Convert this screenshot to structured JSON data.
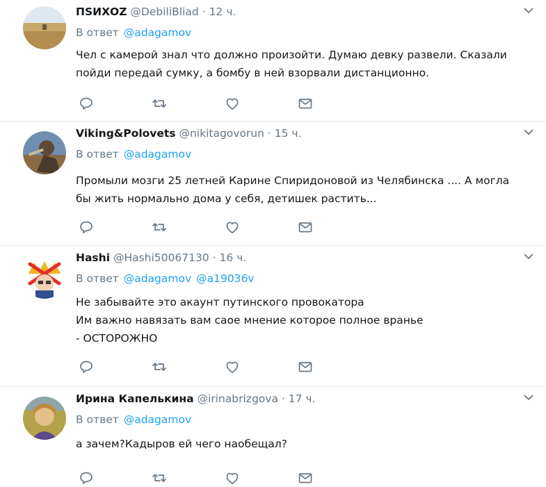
{
  "tweets": [
    {
      "name": "ПSИХОZ",
      "handle": "@DebiliBliad",
      "dot": "·",
      "time": "12 ч.",
      "reply_label": "В ответ",
      "mentions": [
        "@adagamov"
      ],
      "lines": [
        "Чел с камерой знал что должно произойти. Думаю девку развели. Сказали",
        "пойди передай сумку, а бомбу в ней взорвали дистанционно."
      ]
    },
    {
      "name": "Viking&Polovets",
      "handle": "@nikitagovorun",
      "dot": "·",
      "time": "15 ч.",
      "reply_label": "В ответ",
      "mentions": [
        "@adagamov"
      ],
      "lines": [
        "Промыли мозги 25 летней  Карине Спиридоновой из Челябинска .... А могла",
        "бы жить нормально дома у себя, детишек растить..."
      ]
    },
    {
      "name": "Hashi",
      "handle": "@Hashi50067130",
      "dot": "·",
      "time": "16 ч.",
      "reply_label": "В ответ",
      "mentions": [
        "@adagamov",
        "@a19036v"
      ],
      "lines": [
        "Не забывайте это акаунт путинского провокатора",
        "Им важно навязать вам саое мнение которое полное вранье",
        "- ОСТОРОЖНО"
      ]
    },
    {
      "name": "Ирина Капелькина",
      "handle": "@irinabrizgova",
      "dot": "·",
      "time": "17 ч.",
      "reply_label": "В ответ",
      "mentions": [
        "@adagamov"
      ],
      "lines": [
        "а зачем?Кадыров ей чего наобещал?"
      ]
    }
  ],
  "icons": [
    "reply-icon",
    "retweet-icon",
    "like-icon",
    "direct-message-icon",
    "chevron-down-icon"
  ],
  "colors": {
    "link": "#1da1f2",
    "muted": "#657786",
    "text": "#14171a",
    "divider": "#e6ecf0"
  }
}
